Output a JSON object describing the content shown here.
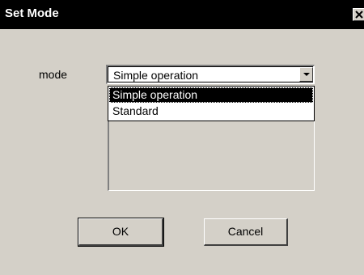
{
  "window": {
    "title": "Set Mode",
    "close_glyph": "×"
  },
  "form": {
    "mode_label": "mode",
    "mode_value": "Simple operation",
    "options": [
      "Simple operation",
      "Standard"
    ],
    "selected_index": 0
  },
  "buttons": {
    "ok_label": "OK",
    "cancel_label": "Cancel"
  },
  "colors": {
    "title_bar": "#000000",
    "dialog_bg": "#d4d0c8",
    "selection_bg": "#000000"
  }
}
